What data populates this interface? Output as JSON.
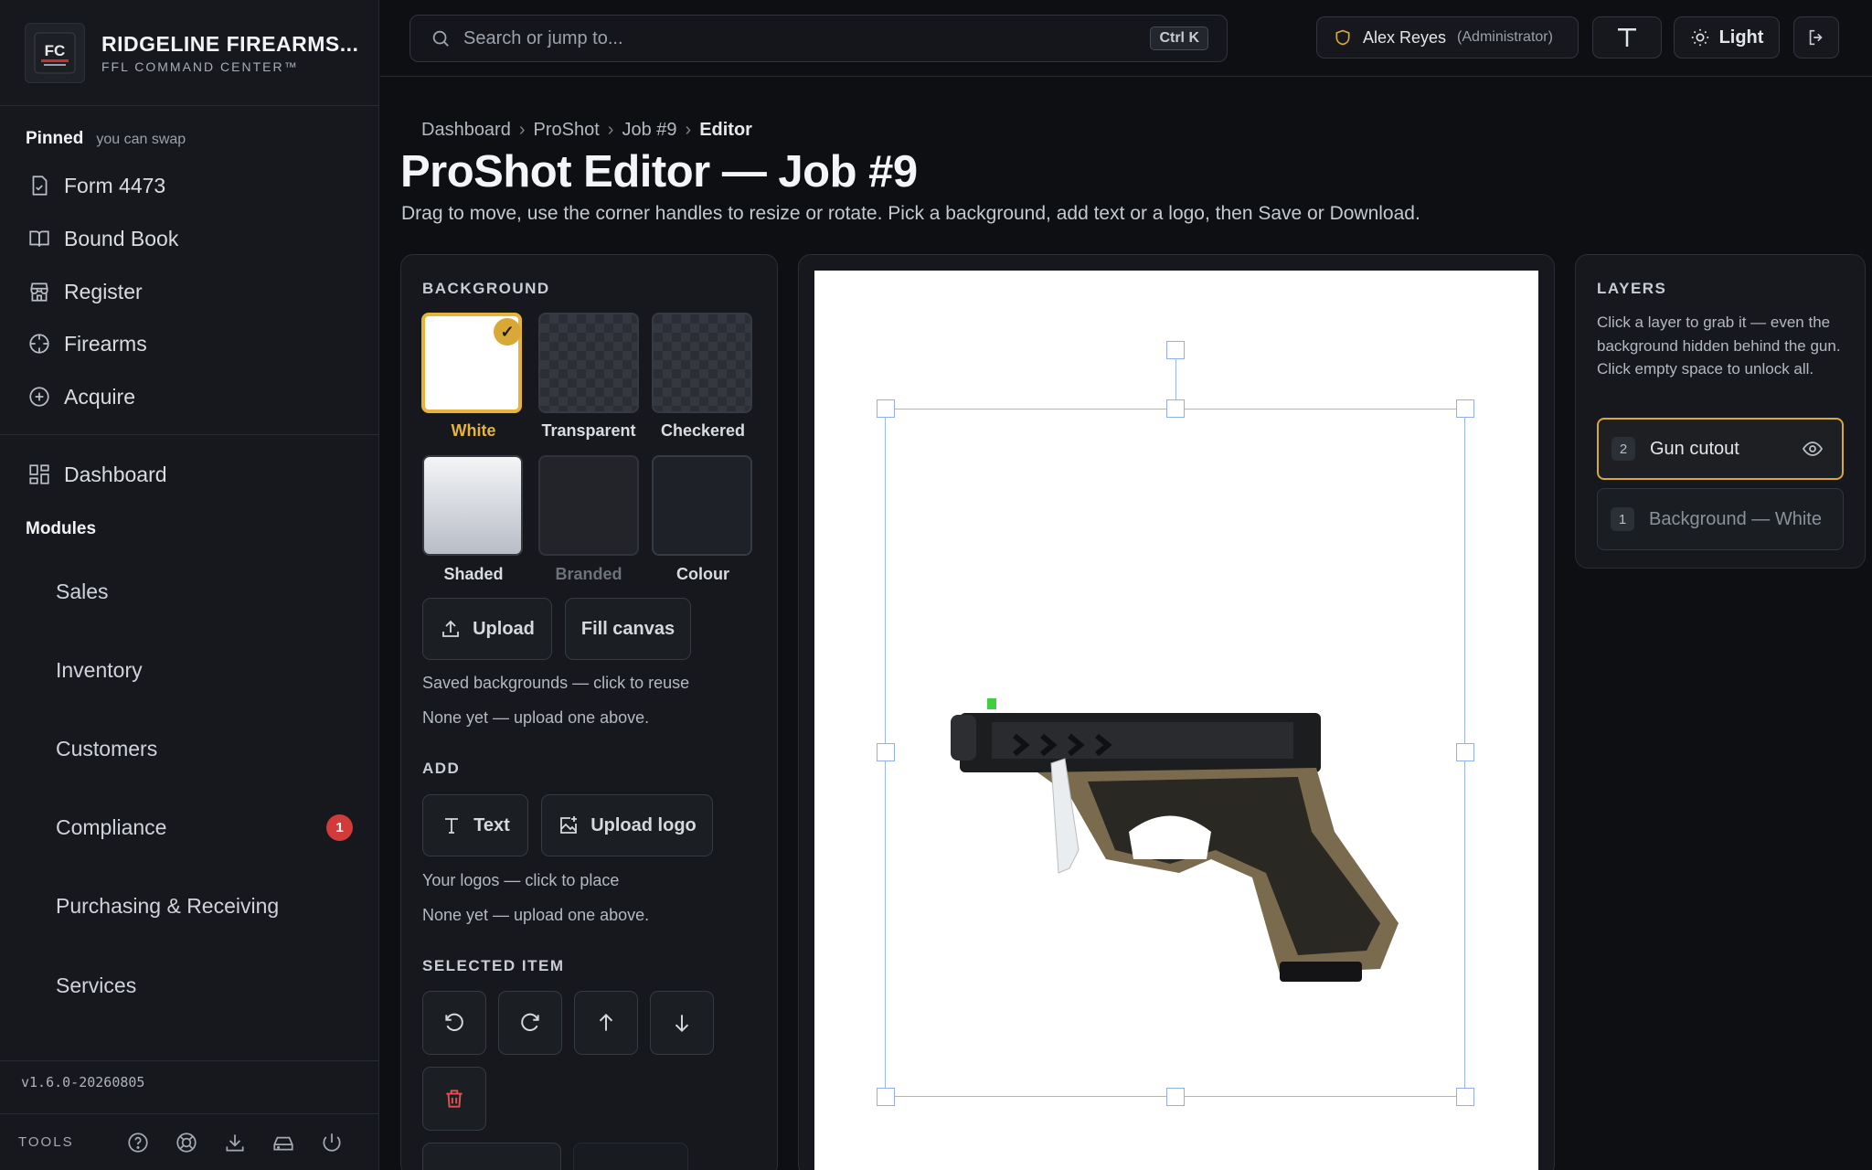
{
  "brand": {
    "title": "RIDGELINE FIREARMS...",
    "subtitle": "FFL COMMAND CENTER™",
    "logo_text": "FC"
  },
  "sidebar": {
    "pinned_title": "Pinned",
    "pinned_hint": "you can swap",
    "pinned": [
      {
        "label": "Form 4473",
        "icon": "form-check-icon"
      },
      {
        "label": "Bound Book",
        "icon": "book-icon"
      },
      {
        "label": "Register",
        "icon": "store-icon"
      },
      {
        "label": "Firearms",
        "icon": "crosshair-icon"
      },
      {
        "label": "Acquire",
        "icon": "plus-circle-icon"
      }
    ],
    "dashboard": "Dashboard",
    "modules_title": "Modules",
    "modules": [
      "Sales",
      "Inventory",
      "Customers",
      "Compliance",
      "Purchasing & Receiving",
      "Services"
    ],
    "compliance_badge": "1",
    "version": "v1.6.0-20260805",
    "tools_label": "TOOLS"
  },
  "topbar": {
    "search_placeholder": "Search or jump to...",
    "shortcut": "Ctrl K",
    "user_name": "Alex Reyes",
    "user_role": "(Administrator)",
    "theme_label": "Light"
  },
  "header": {
    "breadcrumb": [
      "Dashboard",
      "ProShot",
      "Job #9",
      "Editor"
    ],
    "title": "ProShot Editor — Job #9",
    "description": "Drag to move, use the corner handles to resize or rotate. Pick a background, add text or a logo, then Save or Download."
  },
  "editor": {
    "background_title": "BACKGROUND",
    "swatches": [
      "White",
      "Transparent",
      "Checkered",
      "Shaded",
      "Branded",
      "Colour"
    ],
    "selected_swatch": "White",
    "upload_label": "Upload",
    "fill_label": "Fill canvas",
    "saved_bg_title": "Saved backgrounds — click to reuse",
    "saved_bg_empty": "None yet — upload one above.",
    "add_title": "ADD",
    "text_label": "Text",
    "upload_logo_label": "Upload logo",
    "logos_title": "Your logos — click to place",
    "logos_empty": "None yet — upload one above.",
    "selected_title": "SELECTED ITEM"
  },
  "layers": {
    "title": "LAYERS",
    "description": "Click a layer to grab it — even the background hidden behind the gun. Click empty space to unlock all.",
    "items": [
      {
        "num": "2",
        "name": "Gun cutout",
        "selected": true
      },
      {
        "num": "1",
        "name": "Background — White",
        "selected": false
      }
    ]
  },
  "colors": {
    "accent": "#d9a938",
    "danger": "#d33b3b",
    "selection": "#9bb7ee"
  }
}
